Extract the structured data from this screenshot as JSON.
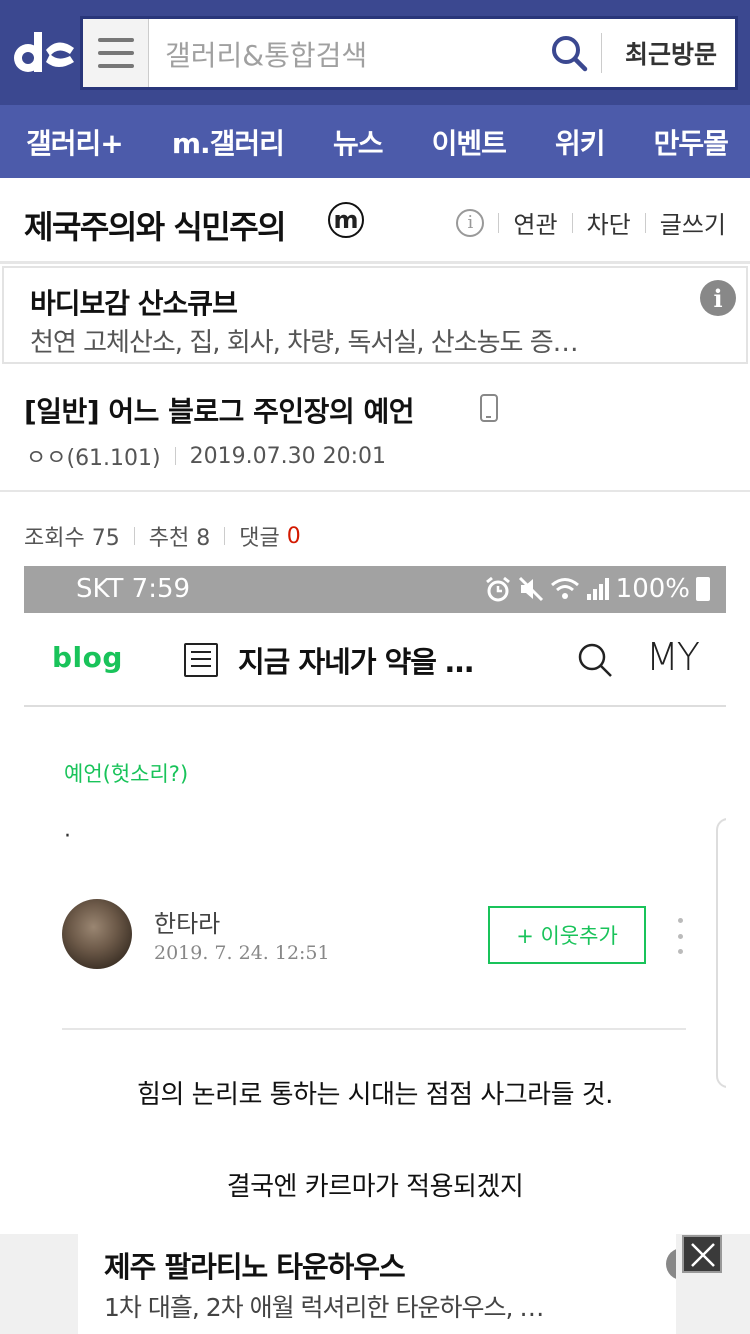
{
  "header": {
    "search_placeholder": "갤러리&통합검색",
    "recent_label": "최근방문"
  },
  "nav": {
    "items": [
      "갤러리+",
      "m.갤러리",
      "뉴스",
      "이벤트",
      "위키",
      "만두몰"
    ]
  },
  "gallery": {
    "title": "제국주의와 식민주의",
    "badge": "m",
    "actions": [
      "연관",
      "차단",
      "글쓰기"
    ]
  },
  "ad": {
    "title": "바디보감 산소큐브",
    "description": "천연 고체산소, 집, 회사, 차량, 독서실, 산소농도 증…"
  },
  "post": {
    "title": "[일반] 어느 블로그 주인장의 예언",
    "author": "ㅇㅇ(61.101)",
    "datetime": "2019.07.30 20:01",
    "views_label": "조회수 75",
    "recommend_label": "추천 8",
    "comments_label": "댓글",
    "comments_count": "0"
  },
  "screenshot": {
    "status_left": "SKT 7:59",
    "status_right": "100%",
    "blog_logo": "blog",
    "blog_title": "지금 자네가 약을 …",
    "my_label": "MY",
    "category": "예언(헛소리?)",
    "bullet": "·",
    "author": "한타라",
    "date": "2019. 7. 24. 12:51",
    "follow_label": "+ 이웃추가",
    "line1": "힘의 논리로 통하는 시대는 점점 사그라들 것.",
    "line2": "결국엔 카르마가 적용되겠지"
  },
  "bottom_ad": {
    "title": "제주 팔라티노 타운하우스",
    "description": "1차 대흘, 2차 애월 럭셔리한 타운하우스, …"
  },
  "colors": {
    "header_bg": "#3b4890",
    "nav_bg": "#4c5baa",
    "blog_green": "#19c35a",
    "comment_red": "#d31900"
  }
}
